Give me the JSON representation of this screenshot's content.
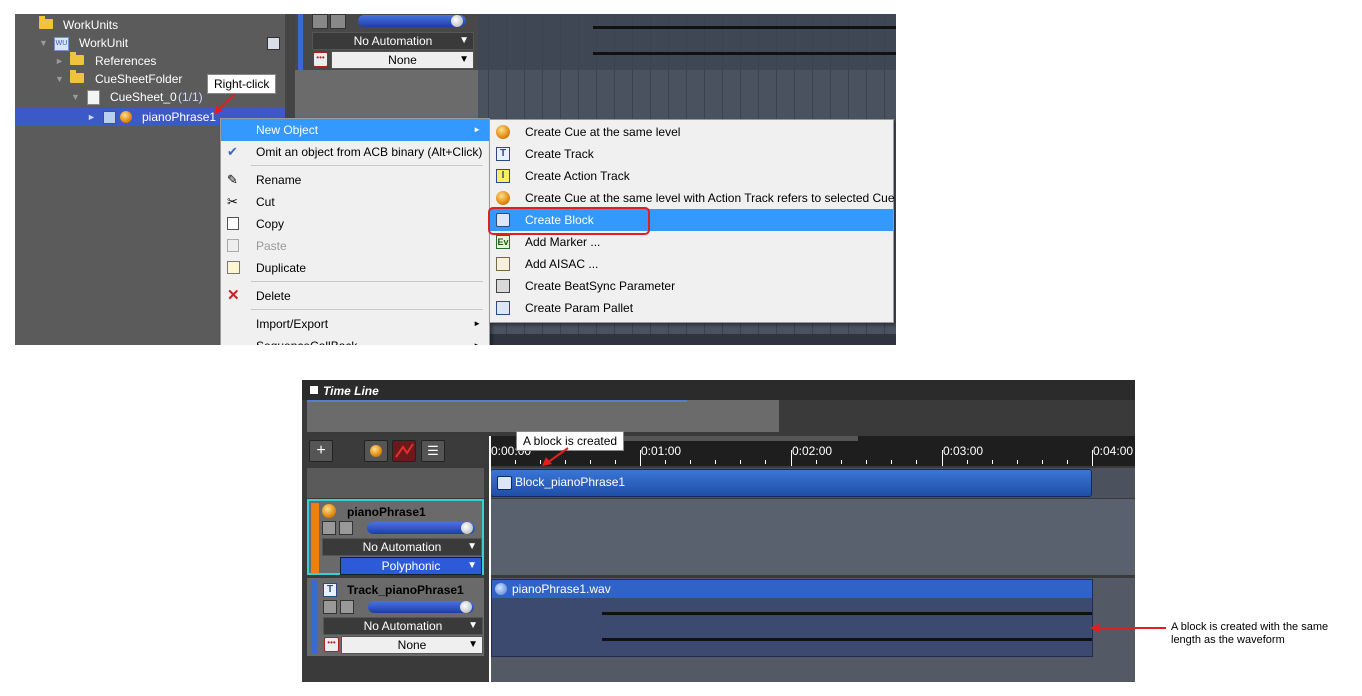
{
  "top": {
    "tree": [
      {
        "label": "WorkUnits",
        "type": "folder"
      },
      {
        "label": "WorkUnit",
        "type": "workunit"
      },
      {
        "label": "References",
        "type": "folder"
      },
      {
        "label": "CueSheetFolder",
        "type": "folder"
      },
      {
        "label": "CueSheet_0",
        "count": "(1/1)",
        "type": "cuesheet"
      },
      {
        "label": "pianoPhrase1",
        "type": "cue"
      }
    ],
    "right_click_callout": "Right-click",
    "mid_panel": {
      "automation": "No Automation",
      "none": "None"
    },
    "context_menu": [
      {
        "label": "New Object",
        "icon": "",
        "submenu": true
      },
      {
        "label": "Omit an object from ACB binary (Alt+Click)",
        "icon": "checkmark-icon"
      },
      {
        "label": "Rename",
        "icon": "pencil-icon"
      },
      {
        "label": "Cut",
        "icon": "scissors-icon"
      },
      {
        "label": "Copy",
        "icon": "copy-icon"
      },
      {
        "label": "Paste",
        "icon": "paste-icon"
      },
      {
        "label": "Duplicate",
        "icon": "duplicate-icon"
      },
      {
        "label": "Delete",
        "icon": "delete-x-icon"
      },
      {
        "label": "Import/Export",
        "icon": "",
        "submenu": true
      },
      {
        "label": "SequenceCallBack",
        "icon": "",
        "submenu": true
      }
    ],
    "submenu": [
      {
        "label": "Create Cue at the same level",
        "icon": "cue-orb-icon"
      },
      {
        "label": "Create Track",
        "icon": "track-t-icon"
      },
      {
        "label": "Create Action Track",
        "icon": "action-track-icon"
      },
      {
        "label": "Create Cue at the same level with Action Track refers to selected Cue",
        "icon": "cue-orb-icon"
      },
      {
        "label": "Create Block",
        "icon": "block-icon"
      },
      {
        "label": "Add Marker ...",
        "icon": "marker-ev-icon"
      },
      {
        "label": "Add AISAC ...",
        "icon": "aisac-icon"
      },
      {
        "label": "Create BeatSync Parameter",
        "icon": "beatsync-icon"
      },
      {
        "label": "Create Param Pallet",
        "icon": "param-pallet-icon"
      }
    ]
  },
  "bottom": {
    "timeline_title": "Time Line",
    "block_created_callout": "A block is created",
    "ruler_labels": [
      "0:00:00",
      "0:01:00",
      "0:02:00",
      "0:03:00",
      "0:04:00"
    ],
    "block_label": "Block_pianoPhrase1",
    "cue_track": {
      "name": "pianoPhrase1",
      "automation": "No Automation",
      "mode": "Polyphonic"
    },
    "audio_track": {
      "name": "Track_pianoPhrase1",
      "automation": "No Automation",
      "none": "None",
      "waveform": "pianoPhrase1.wav"
    },
    "side_note": "A block is created with the same length as the waveform",
    "colors": {
      "accent_orange": "#f07d10",
      "cue_blue": "#3a76d6",
      "highlight": "#3399ff",
      "callout_red": "#e02020"
    }
  }
}
